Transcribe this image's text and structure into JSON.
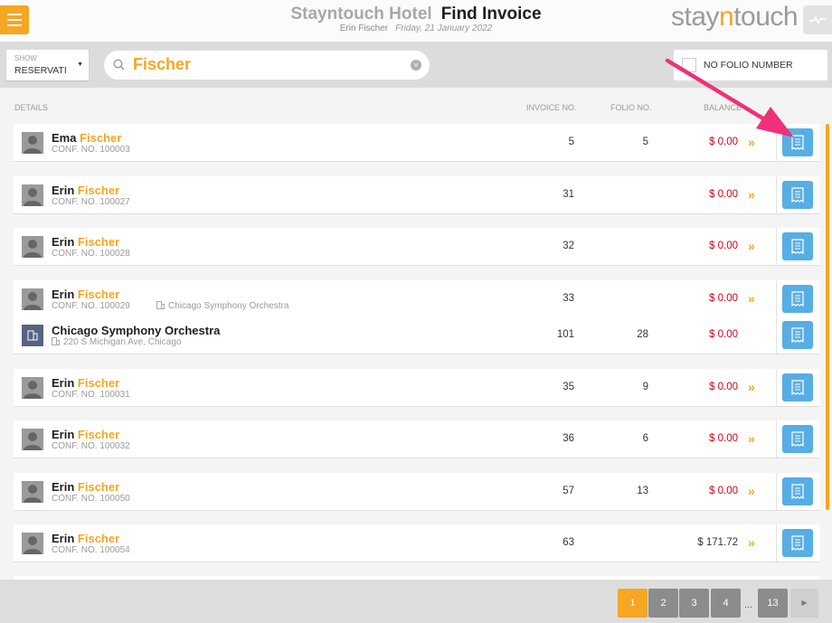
{
  "header": {
    "hotel_name": "Stayntouch Hotel",
    "page_title": "Find Invoice",
    "user_name": "Erin Fischer",
    "date": "Friday, 21 January 2022",
    "logo": {
      "pre": "stay",
      "accent": "n",
      "post": "touch"
    }
  },
  "filters": {
    "show_label": "SHOW",
    "show_value": "RESERVATI...",
    "search_value": "Fischer",
    "no_folio_label": "NO FOLIO NUMBER"
  },
  "columns": {
    "details": "DETAILS",
    "invoice_no": "INVOICE NO.",
    "folio_no": "FOLIO NO.",
    "balance": "BALANCE"
  },
  "rows": [
    {
      "first": "Ema",
      "last": "Fischer",
      "conf": "CONF. NO. 100003",
      "invoice": "5",
      "folio": "5",
      "balance": "$ 0.00"
    },
    {
      "first": "Erin",
      "last": "Fischer",
      "conf": "CONF. NO. 100027",
      "invoice": "31",
      "folio": "",
      "balance": "$ 0.00"
    },
    {
      "first": "Erin",
      "last": "Fischer",
      "conf": "CONF. NO. 100028",
      "invoice": "32",
      "folio": "",
      "balance": "$ 0.00"
    },
    {
      "first": "Erin",
      "last": "Fischer",
      "conf": "CONF. NO. 100029",
      "company": "Chicago Symphony Orchestra",
      "invoice": "33",
      "folio": "",
      "balance": "$ 0.00",
      "sub": {
        "name": "Chicago Symphony Orchestra",
        "address": "220 S Michigan Ave, Chicago",
        "invoice": "101",
        "folio": "28",
        "balance": "$ 0.00"
      }
    },
    {
      "first": "Erin",
      "last": "Fischer",
      "conf": "CONF. NO. 100031",
      "invoice": "35",
      "folio": "9",
      "balance": "$ 0.00"
    },
    {
      "first": "Erin",
      "last": "Fischer",
      "conf": "CONF. NO. 100032",
      "invoice": "36",
      "folio": "6",
      "balance": "$ 0.00"
    },
    {
      "first": "Erin",
      "last": "Fischer",
      "conf": "CONF. NO. 100050",
      "invoice": "57",
      "folio": "13",
      "balance": "$ 0.00"
    },
    {
      "first": "Erin",
      "last": "Fischer",
      "conf": "CONF. NO. 100054",
      "invoice": "63",
      "folio": "",
      "balance": "$ 171.72"
    }
  ],
  "pagination": {
    "pages": [
      "1",
      "2",
      "3",
      "4"
    ],
    "ellipsis": "...",
    "last_page": "13",
    "current": "1"
  },
  "colors": {
    "accent": "#f5a623",
    "negative_balance": "#d0021b",
    "invoice_button": "#57aee4",
    "annotation_arrow": "#f0307a"
  }
}
